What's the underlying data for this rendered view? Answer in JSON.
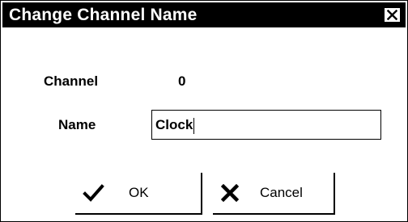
{
  "window": {
    "title": "Change Channel Name"
  },
  "fields": {
    "channel_label": "Channel",
    "channel_value": "0",
    "name_label": "Name",
    "name_value": "Clock"
  },
  "buttons": {
    "ok_label": "OK",
    "cancel_label": "Cancel"
  },
  "icons": {
    "close": "close-icon",
    "ok": "checkmark-icon",
    "cancel": "x-icon"
  }
}
